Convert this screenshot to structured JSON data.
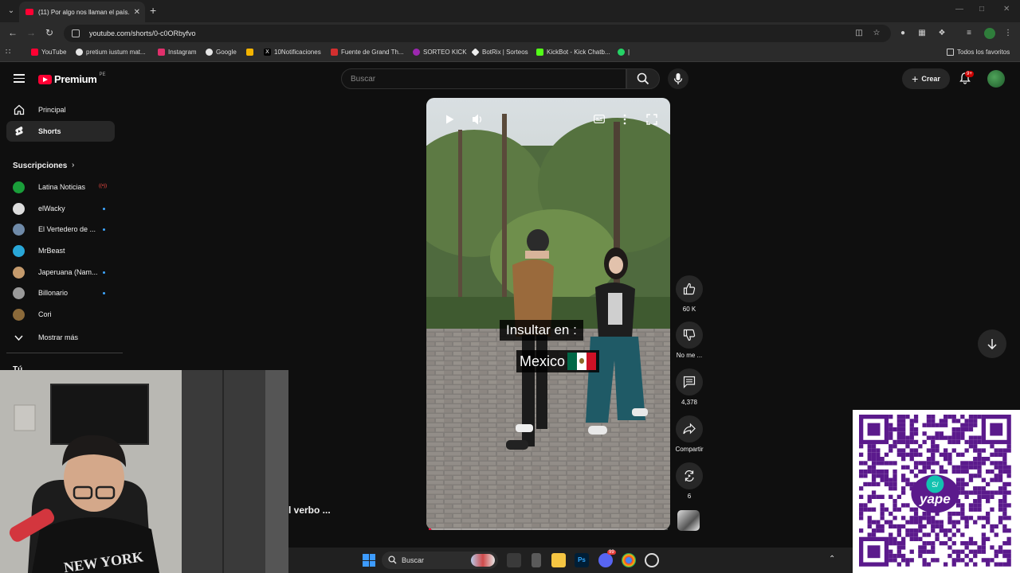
{
  "browser": {
    "tab_title": "(11) Por algo nos llaman el país...",
    "url": "youtube.com/shorts/0-c0ORbyfvo",
    "bookmarks": [
      {
        "label": "YouTube",
        "color": "#ff0033"
      },
      {
        "label": "pretium iustum mat...",
        "color": "#e6e6e6"
      },
      {
        "label": "Instagram",
        "color": "#e1306c"
      },
      {
        "label": "Google",
        "color": "#4285f4"
      },
      {
        "label": "",
        "color": "#f4b400"
      },
      {
        "label": "10Notificaciones",
        "color": "#000000"
      },
      {
        "label": "Fuente de Grand Th...",
        "color": "#d32f2f"
      },
      {
        "label": "SORTEO KICK",
        "color": "#9c27b0"
      },
      {
        "label": "BotRix | Sorteos",
        "color": "#eeeeee"
      },
      {
        "label": "KickBot - Kick Chatb...",
        "color": "#53fc18"
      },
      {
        "label": "|",
        "color": "#25d366"
      }
    ],
    "all_bookmarks": "Todos los favoritos"
  },
  "youtube": {
    "logo_text": "Premium",
    "country_code": "PE",
    "search_placeholder": "Buscar",
    "create_label": "Crear",
    "notifications_badge": "9+"
  },
  "sidebar": {
    "nav": [
      {
        "label": "Principal",
        "icon": "home-icon"
      },
      {
        "label": "Shorts",
        "icon": "shorts-icon"
      }
    ],
    "subscriptions_title": "Suscripciones",
    "subscriptions": [
      {
        "name": "Latina Noticias",
        "status": "live",
        "color": "#1a9e3a"
      },
      {
        "name": "elWacky",
        "status": "new",
        "color": "#dddddd"
      },
      {
        "name": "El Vertedero de ...",
        "status": "new",
        "color": "#6f8aa8"
      },
      {
        "name": "MrBeast",
        "status": "none",
        "color": "#29a7d8"
      },
      {
        "name": "Japeruana (Nam...",
        "status": "new",
        "color": "#c49a6c"
      },
      {
        "name": "Billonario",
        "status": "new",
        "color": "#9a9a9a"
      },
      {
        "name": "Cori",
        "status": "none",
        "color": "#8b6a3a"
      }
    ],
    "show_more": "Mostrar más",
    "you_label": "Tú"
  },
  "short": {
    "caption_line1": "Insultar en :",
    "caption_line2": "Mexico",
    "progress": 0.01,
    "flag_colors": [
      "#006847",
      "#ffffff",
      "#ce1126"
    ],
    "overlay_text": "l verbo  ..."
  },
  "actions": {
    "likes": "60 K",
    "dislike_label": "No me ...",
    "comments": "4,378",
    "share_label": "Compartir",
    "remix_count": "6"
  },
  "taskbar": {
    "search_label": "Buscar",
    "photoshop_label": "Ps",
    "discord_badge": "99"
  },
  "colors": {
    "youtube_red": "#ff0033",
    "background": "#0f0f0f",
    "qr_purple": "#5b1a8c",
    "yape_teal": "#12c2b0"
  },
  "qr": {
    "brand_text": "yape",
    "currency": "S/"
  }
}
